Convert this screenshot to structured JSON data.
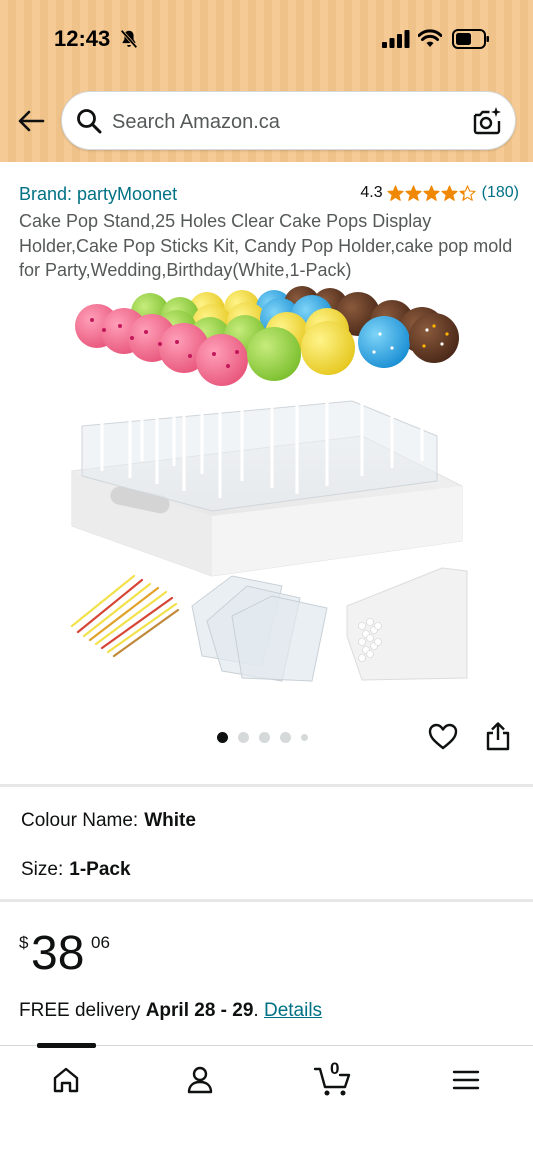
{
  "status_bar": {
    "time": "12:43"
  },
  "search": {
    "placeholder": "Search Amazon.ca"
  },
  "product": {
    "brand": "Brand: partyMoonet",
    "rating": "4.3",
    "rating_stars": 4.3,
    "rating_count": "(180)",
    "title": "Cake Pop Stand,25 Holes Clear Cake Pops Display Holder,Cake Pop Sticks Kit, Candy Pop Holder,cake pop mold for Party,Wedding,Birthday(White,1-Pack)"
  },
  "gallery": {
    "image_count": 5,
    "active_index": 0
  },
  "variations": {
    "colour_label": "Colour Name:",
    "colour_value": "White",
    "size_label": "Size:",
    "size_value": "1-Pack"
  },
  "price": {
    "symbol": "$",
    "whole": "38",
    "fraction": "06"
  },
  "delivery": {
    "prefix": "FREE delivery",
    "dates": "April 28 - 29",
    "separator": ".",
    "link": "Details"
  },
  "cart": {
    "count": "0"
  },
  "colors": {
    "header_bg": "#f4c68c",
    "link": "#007185",
    "star": "#f08804",
    "text": "#0f1111",
    "muted": "#565959"
  },
  "icons": {
    "back": "arrow-left-icon",
    "search": "search-icon",
    "camera": "camera-search-icon",
    "heart": "heart-icon",
    "share": "share-icon",
    "home": "home-icon",
    "account": "person-icon",
    "cart": "cart-icon",
    "menu": "hamburger-menu-icon"
  }
}
